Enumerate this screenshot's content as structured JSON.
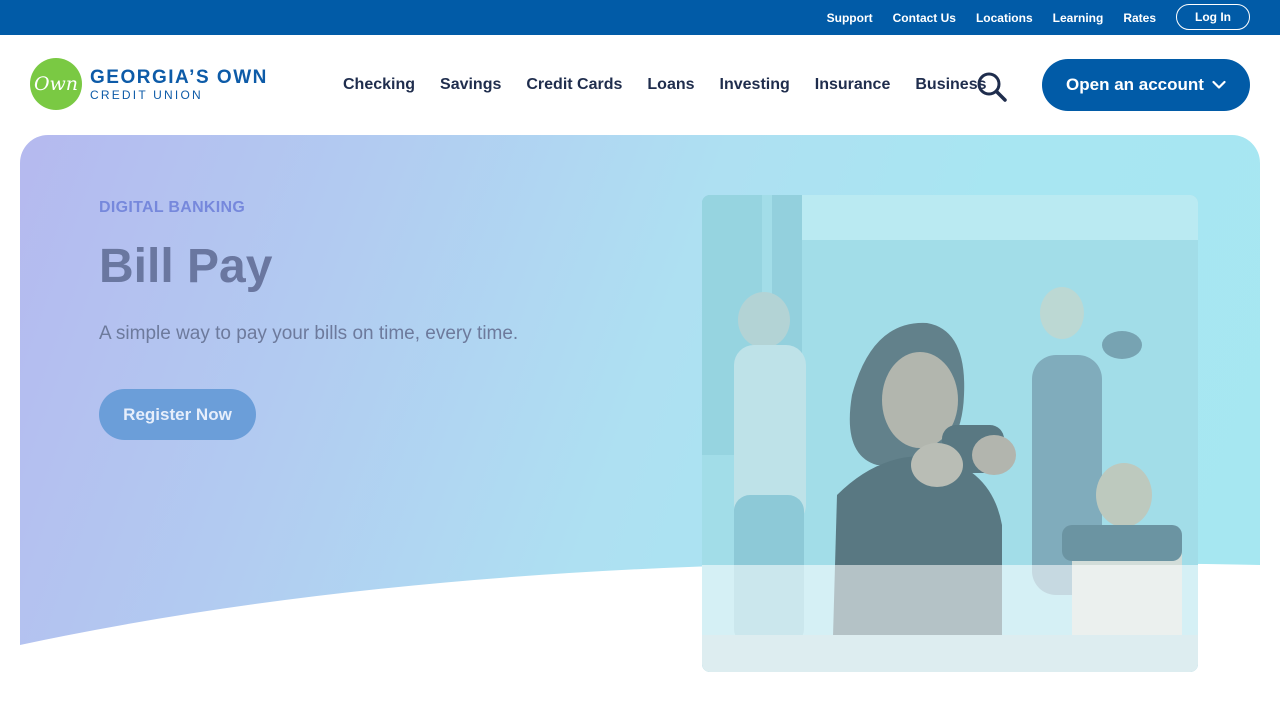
{
  "utility": {
    "links": [
      "Support",
      "Contact Us",
      "Locations",
      "Learning",
      "Rates"
    ],
    "login_label": "Log In"
  },
  "logo": {
    "badge_text": "Own",
    "line1": "GEORGIA’S OWN",
    "line2": "CREDIT UNION"
  },
  "nav": {
    "items": [
      "Checking",
      "Savings",
      "Credit Cards",
      "Loans",
      "Investing",
      "Insurance",
      "Business"
    ],
    "search_icon": "search-icon",
    "open_account_label": "Open an account"
  },
  "hero": {
    "eyebrow": "DIGITAL BANKING",
    "title": "Bill Pay",
    "subtitle": "A simple way to pay your bills on time, every time.",
    "cta_label": "Register Now"
  },
  "colors": {
    "brand_blue": "#015ba7",
    "logo_green": "#7ac943",
    "nav_text": "#1f2d4d"
  }
}
